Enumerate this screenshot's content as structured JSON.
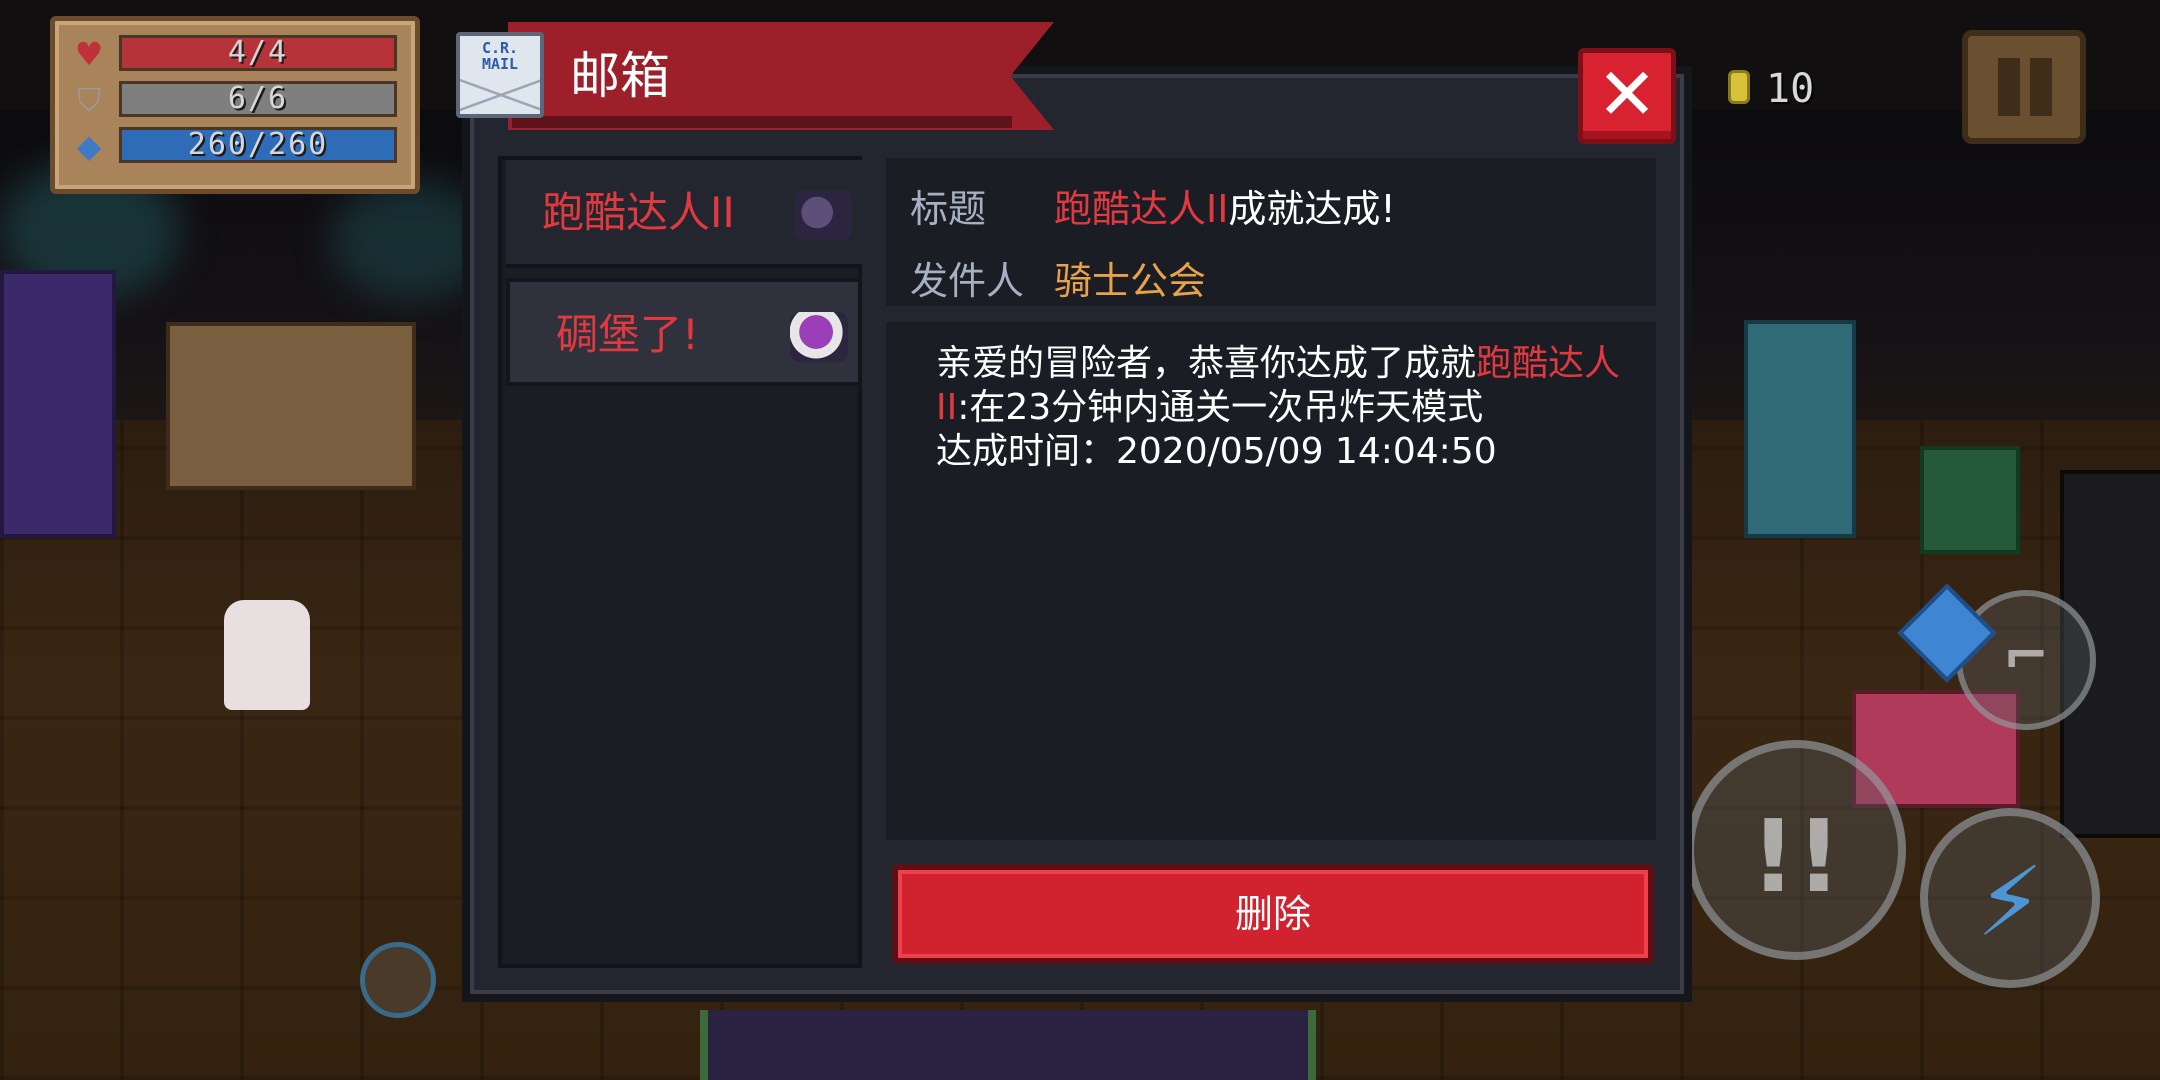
{
  "hud": {
    "health": "4/4",
    "armor": "6/6",
    "energy": "260/260",
    "gold": "10"
  },
  "mailbox": {
    "title": "邮箱",
    "icon_text": "C.R. MAIL",
    "close_label": "✕",
    "mails": [
      {
        "title": "跑酷达人II",
        "selected": false
      },
      {
        "title": "碉堡了!",
        "selected": true
      }
    ],
    "detail": {
      "subject_label": "标题",
      "subject_highlight": "跑酷达人II",
      "subject_rest": "成就达成!",
      "sender_label": "发件人",
      "sender": "骑士公会",
      "body_prefix": "亲爱的冒险者，恭喜你达成了成就",
      "body_highlight": "跑酷达人II",
      "body_suffix": ":在23分钟内通关一次吊炸天模式",
      "body_time": "达成时间：2020/05/09 14:04:50"
    },
    "delete_label": "删除"
  },
  "colors": {
    "accent_red": "#e03a40",
    "sender_orange": "#e8a24a",
    "panel_bg": "#23262f",
    "banner_red": "#9c1f2a"
  }
}
